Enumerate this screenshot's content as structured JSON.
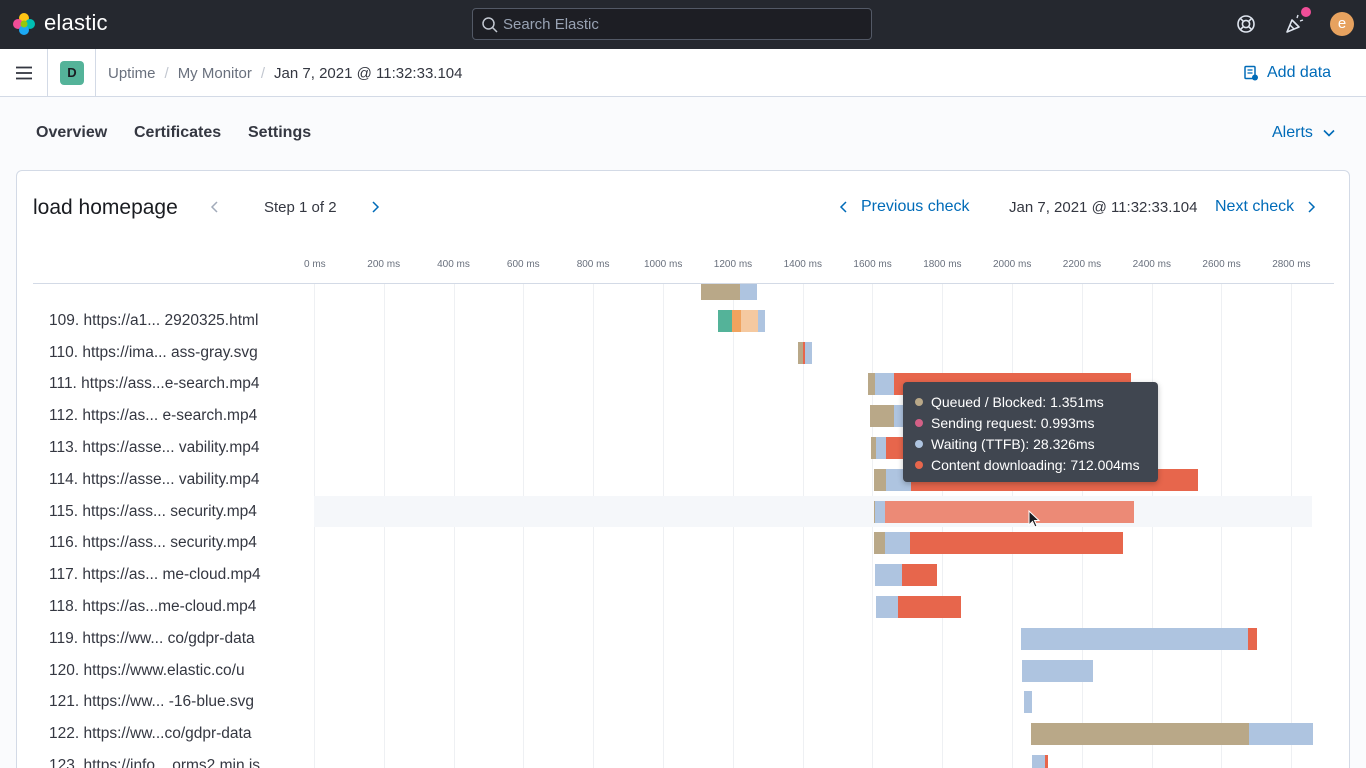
{
  "header": {
    "logo_text": "elastic",
    "search_placeholder": "Search Elastic",
    "avatar_letter": "e"
  },
  "breadcrumb": {
    "space_letter": "D",
    "items": [
      "Uptime",
      "My Monitor",
      "Jan 7, 2021 @ 11:32:33.104"
    ],
    "add_data_label": "Add data"
  },
  "subnav": {
    "tabs": [
      "Overview",
      "Certificates",
      "Settings"
    ],
    "alerts_label": "Alerts"
  },
  "step": {
    "title": "load homepage",
    "step_label": "Step 1 of 2",
    "prev_check_label": "Previous check",
    "check_date": "Jan 7, 2021 @ 11:32:33.104",
    "next_check_label": "Next check"
  },
  "colors": {
    "queued": "#b9a888",
    "sending": "#d36086",
    "waiting": "#aec4e0",
    "content": "#e7664c",
    "ssl": "#54b399",
    "connect": "#f0a35e",
    "dns": "#f5c9a0",
    "accent": "#006bb8"
  },
  "chart_data": {
    "type": "waterfall",
    "x_unit": "ms",
    "x_ticks": [
      0,
      200,
      400,
      600,
      800,
      1000,
      1200,
      1400,
      1600,
      1800,
      2000,
      2200,
      2400,
      2600,
      2800
    ],
    "x_tick_labels": [
      "0 ms",
      "200 ms",
      "400 ms",
      "600 ms",
      "800 ms",
      "1000 ms",
      "1200 ms",
      "1400 ms",
      "1600 ms",
      "1800 ms",
      "2000 ms",
      "2200 ms",
      "2400 ms",
      "2600 ms",
      "2800 ms"
    ],
    "xlim": [
      0,
      2870
    ],
    "rows": [
      {
        "label": "",
        "segments": [
          {
            "type": "queued",
            "start": 1109,
            "end": 1222
          },
          {
            "type": "waiting",
            "start": 1222,
            "end": 1268
          }
        ]
      },
      {
        "label": "109. https://a1... 2920325.html",
        "segments": [
          {
            "type": "ssl",
            "start": 1158,
            "end": 1198
          },
          {
            "type": "connect",
            "start": 1198,
            "end": 1224
          },
          {
            "type": "dns",
            "start": 1224,
            "end": 1272
          },
          {
            "type": "waiting",
            "start": 1272,
            "end": 1291
          }
        ]
      },
      {
        "label": "110. https://ima... ass-gray.svg",
        "segments": [
          {
            "type": "queued",
            "start": 1388,
            "end": 1402
          },
          {
            "type": "content",
            "start": 1402,
            "end": 1408
          },
          {
            "type": "waiting",
            "start": 1408,
            "end": 1427
          }
        ]
      },
      {
        "label": "111. https://ass...e-search.mp4",
        "segments": [
          {
            "type": "queued",
            "start": 1588,
            "end": 1608
          },
          {
            "type": "waiting",
            "start": 1608,
            "end": 1661
          },
          {
            "type": "content",
            "start": 1661,
            "end": 2340
          }
        ]
      },
      {
        "label": "112. https://as... e-search.mp4",
        "segments": [
          {
            "type": "queued",
            "start": 1594,
            "end": 1662
          },
          {
            "type": "waiting",
            "start": 1662,
            "end": 1690
          },
          {
            "type": "content",
            "start": 1690,
            "end": 2380
          }
        ]
      },
      {
        "label": "113. https://asse... vability.mp4",
        "segments": [
          {
            "type": "queued",
            "start": 1596,
            "end": 1610
          },
          {
            "type": "waiting",
            "start": 1610,
            "end": 1640
          },
          {
            "type": "content",
            "start": 1640,
            "end": 2360
          }
        ]
      },
      {
        "label": "114. https://asse... vability.mp4",
        "segments": [
          {
            "type": "queued",
            "start": 1604,
            "end": 1640
          },
          {
            "type": "waiting",
            "start": 1640,
            "end": 1710
          },
          {
            "type": "content",
            "start": 1710,
            "end": 2533
          }
        ]
      },
      {
        "label": "115. https://ass... security.mp4",
        "highlighted": true,
        "segments": [
          {
            "type": "queued",
            "start": 1606,
            "end": 1607.4
          },
          {
            "type": "sending",
            "start": 1607.4,
            "end": 1608.4
          },
          {
            "type": "waiting",
            "start": 1608.4,
            "end": 1637
          },
          {
            "type": "content",
            "start": 1637,
            "end": 2349
          }
        ]
      },
      {
        "label": "116. https://ass... security.mp4",
        "segments": [
          {
            "type": "queued",
            "start": 1606,
            "end": 1635
          },
          {
            "type": "waiting",
            "start": 1635,
            "end": 1708
          },
          {
            "type": "content",
            "start": 1708,
            "end": 2318
          }
        ]
      },
      {
        "label": "117. https://as... me-cloud.mp4",
        "segments": [
          {
            "type": "waiting",
            "start": 1608,
            "end": 1684
          },
          {
            "type": "content",
            "start": 1684,
            "end": 1786
          }
        ]
      },
      {
        "label": "118. https://as...me-cloud.mp4",
        "segments": [
          {
            "type": "waiting",
            "start": 1610,
            "end": 1672
          },
          {
            "type": "content",
            "start": 1672,
            "end": 1854
          }
        ]
      },
      {
        "label": "119. https://ww... co/gdpr-data",
        "segments": [
          {
            "type": "waiting",
            "start": 2026,
            "end": 2676
          },
          {
            "type": "content",
            "start": 2676,
            "end": 2702
          }
        ]
      },
      {
        "label": "120. https://www.elastic.co/u",
        "segments": [
          {
            "type": "waiting",
            "start": 2028,
            "end": 2232
          }
        ]
      },
      {
        "label": "121. https://ww...  -16-blue.svg",
        "segments": [
          {
            "type": "waiting",
            "start": 2033,
            "end": 2056
          }
        ]
      },
      {
        "label": "122. https://ww...co/gdpr-data",
        "segments": [
          {
            "type": "queued",
            "start": 2055,
            "end": 2679
          },
          {
            "type": "waiting",
            "start": 2679,
            "end": 2862
          }
        ]
      },
      {
        "label": "123. https://info... orms2.min.js",
        "segments": [
          {
            "type": "waiting",
            "start": 2058,
            "end": 2094
          },
          {
            "type": "content",
            "start": 2094,
            "end": 2102
          }
        ]
      }
    ],
    "tooltip": [
      {
        "type": "queued",
        "text": "Queued / Blocked: 1.351ms"
      },
      {
        "type": "sending",
        "text": "Sending request: 0.993ms"
      },
      {
        "type": "waiting",
        "text": "Waiting (TTFB): 28.326ms"
      },
      {
        "type": "content",
        "text": "Content downloading: 712.004ms"
      }
    ]
  }
}
